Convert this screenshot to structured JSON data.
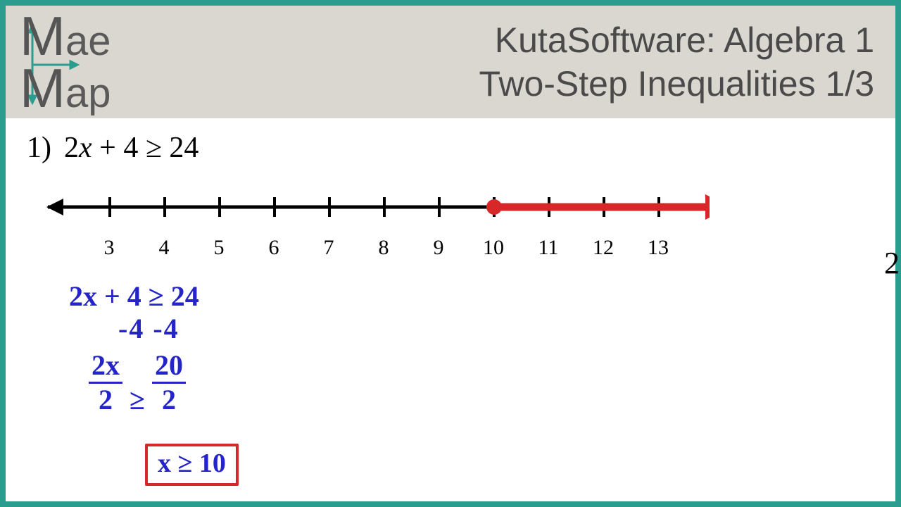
{
  "logo": {
    "line1_big": "M",
    "line1_rest": "ae",
    "line2_big": "M",
    "line2_rest": "ap"
  },
  "title": {
    "line1": "KutaSoftware: Algebra 1",
    "line2": "Two-Step Inequalities 1/3"
  },
  "problem": {
    "number": "1)",
    "expression_a": "2",
    "expression_x": "x",
    "expression_b": " + 4 ≥ 24"
  },
  "chart_data": {
    "type": "numberline",
    "ticks": [
      3,
      4,
      5,
      6,
      7,
      8,
      9,
      10,
      11,
      12,
      13
    ],
    "closed_point": 10,
    "ray_direction": "right",
    "axis_range": [
      2.2,
      13.8
    ]
  },
  "work": {
    "line1": "2x + 4 ≥ 24",
    "line2": "-4      -4",
    "frac1_top": "2x",
    "frac1_bot": "2",
    "mid": " ≥ ",
    "frac2_top": "20",
    "frac2_bot": "2"
  },
  "answer": "x ≥ 10",
  "peek": "2",
  "colors": {
    "accent": "#2a9d8f",
    "ink": "#2424c9",
    "mark": "#d62828"
  }
}
